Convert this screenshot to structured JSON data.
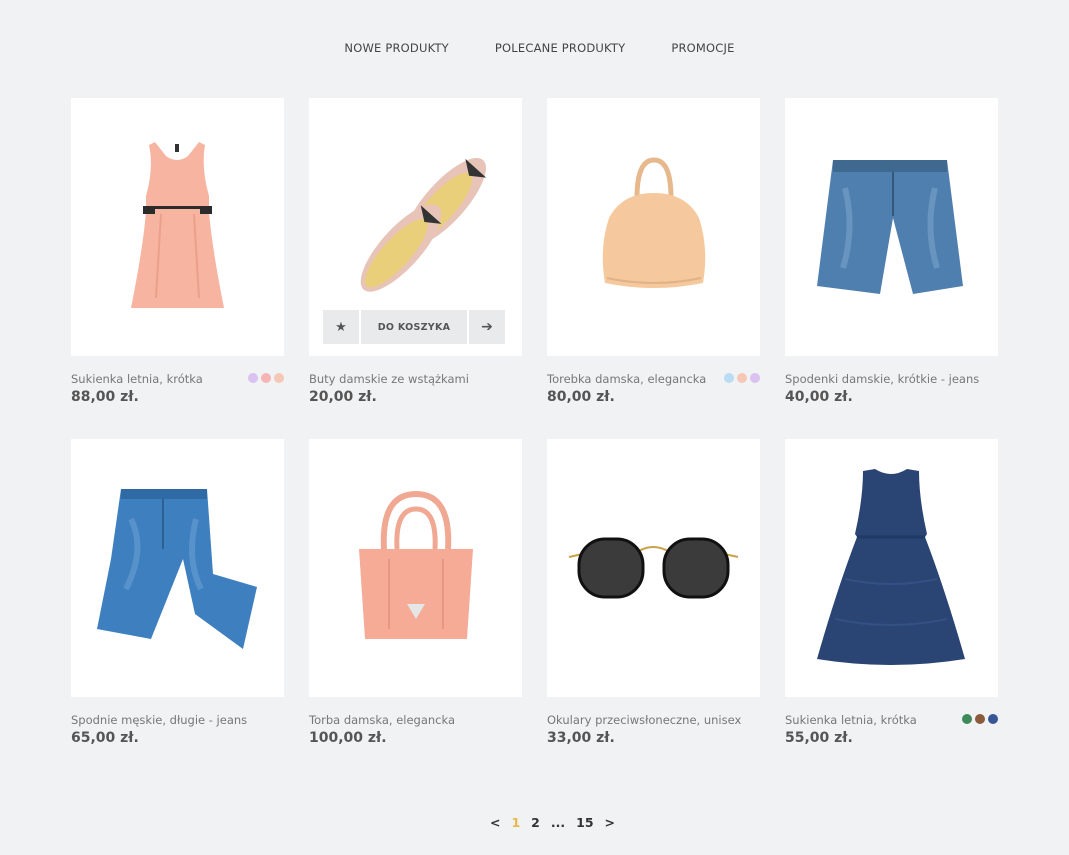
{
  "nav": {
    "tabs": [
      "NOWE PRODUKTY",
      "POLECANE PRODUKTY",
      "PROMOCJE"
    ]
  },
  "hover_actions": {
    "star_icon": "star-icon",
    "cart_label": "DO KOSZYKA",
    "arrow_icon": "arrow-right-icon"
  },
  "products": [
    {
      "name": "Sukienka letnia, krótka",
      "price": "88,00 zł.",
      "image": "pink-dress",
      "swatches": [
        "#d9c1f0",
        "#f5b5b5",
        "#f5c7b5"
      ]
    },
    {
      "name": "Buty damskie ze wstążkami",
      "price": "20,00 zł.",
      "image": "ballet-flats",
      "swatches": []
    },
    {
      "name": "Torebka damska, elegancka",
      "price": "80,00 zł.",
      "image": "beige-handbag",
      "swatches": [
        "#b9dcf3",
        "#f5c7b5",
        "#d9c1f0"
      ]
    },
    {
      "name": "Spodenki damskie, krótkie - jeans",
      "price": "40,00 zł.",
      "image": "denim-shorts",
      "swatches": []
    },
    {
      "name": "Spodnie męskie, długie - jeans",
      "price": "65,00 zł.",
      "image": "jeans",
      "swatches": []
    },
    {
      "name": "Torba damska, elegancka",
      "price": "100,00 zł.",
      "image": "pink-handbag",
      "swatches": []
    },
    {
      "name": "Okulary przeciwsłoneczne, unisex",
      "price": "33,00 zł.",
      "image": "sunglasses",
      "swatches": []
    },
    {
      "name": "Sukienka letnia, krótka",
      "price": "55,00 zł.",
      "image": "navy-dress",
      "swatches": [
        "#3f8a5a",
        "#8b5a3c",
        "#3a5596"
      ]
    }
  ],
  "pagination": {
    "prev": "<",
    "pages": [
      "1",
      "2",
      "...",
      "15"
    ],
    "active": "1",
    "next": ">"
  }
}
